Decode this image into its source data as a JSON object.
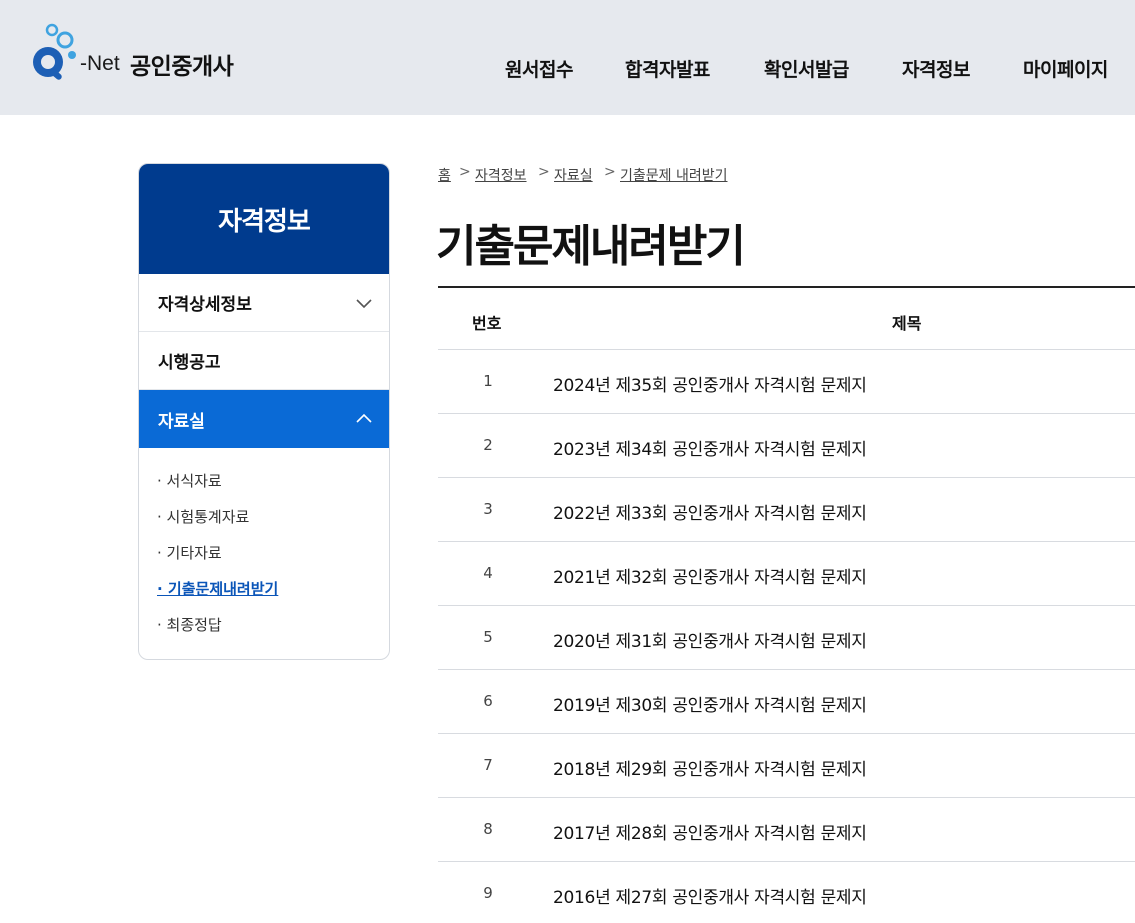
{
  "header": {
    "logo_text": "-Net",
    "site_title": "공인중개사",
    "nav": [
      {
        "label": "원서접수"
      },
      {
        "label": "합격자발표"
      },
      {
        "label": "확인서발급"
      },
      {
        "label": "자격정보"
      },
      {
        "label": "마이페이지"
      }
    ]
  },
  "sidebar": {
    "title": "자격정보",
    "menus": [
      {
        "label": "자격상세정보",
        "icon": "chevron-down-icon"
      },
      {
        "label": "시행공고"
      },
      {
        "label": "자료실",
        "icon": "chevron-up-icon",
        "active": true
      }
    ],
    "sub_items": [
      {
        "label": "· 서식자료"
      },
      {
        "label": "· 시험통계자료"
      },
      {
        "label": "· 기타자료"
      },
      {
        "label": "· 기출문제내려받기",
        "current": true
      },
      {
        "label": "· 최종정답"
      }
    ]
  },
  "breadcrumb": {
    "items": [
      "홈",
      "자격정보",
      "자료실",
      "기출문제 내려받기"
    ],
    "separator": ">"
  },
  "page_title": "기출문제내려받기",
  "table": {
    "columns": [
      "번호",
      "제목"
    ],
    "rows": [
      {
        "num": "1",
        "title": "2024년 제35회 공인중개사 자격시험 문제지"
      },
      {
        "num": "2",
        "title": "2023년 제34회 공인중개사 자격시험 문제지"
      },
      {
        "num": "3",
        "title": "2022년 제33회 공인중개사 자격시험 문제지"
      },
      {
        "num": "4",
        "title": "2021년 제32회 공인중개사 자격시험 문제지"
      },
      {
        "num": "5",
        "title": "2020년 제31회 공인중개사 자격시험 문제지"
      },
      {
        "num": "6",
        "title": "2019년 제30회 공인중개사 자격시험 문제지"
      },
      {
        "num": "7",
        "title": "2018년 제29회 공인중개사 자격시험 문제지"
      },
      {
        "num": "8",
        "title": "2017년 제28회 공인중개사 자격시험 문제지"
      },
      {
        "num": "9",
        "title": "2016년 제27회 공인중개사 자격시험 문제지"
      }
    ]
  },
  "colors": {
    "header_bg": "#e6e9ee",
    "sidebar_head": "#003b8e",
    "active_menu": "#0a6ad6",
    "link_current": "#0a55b8"
  }
}
